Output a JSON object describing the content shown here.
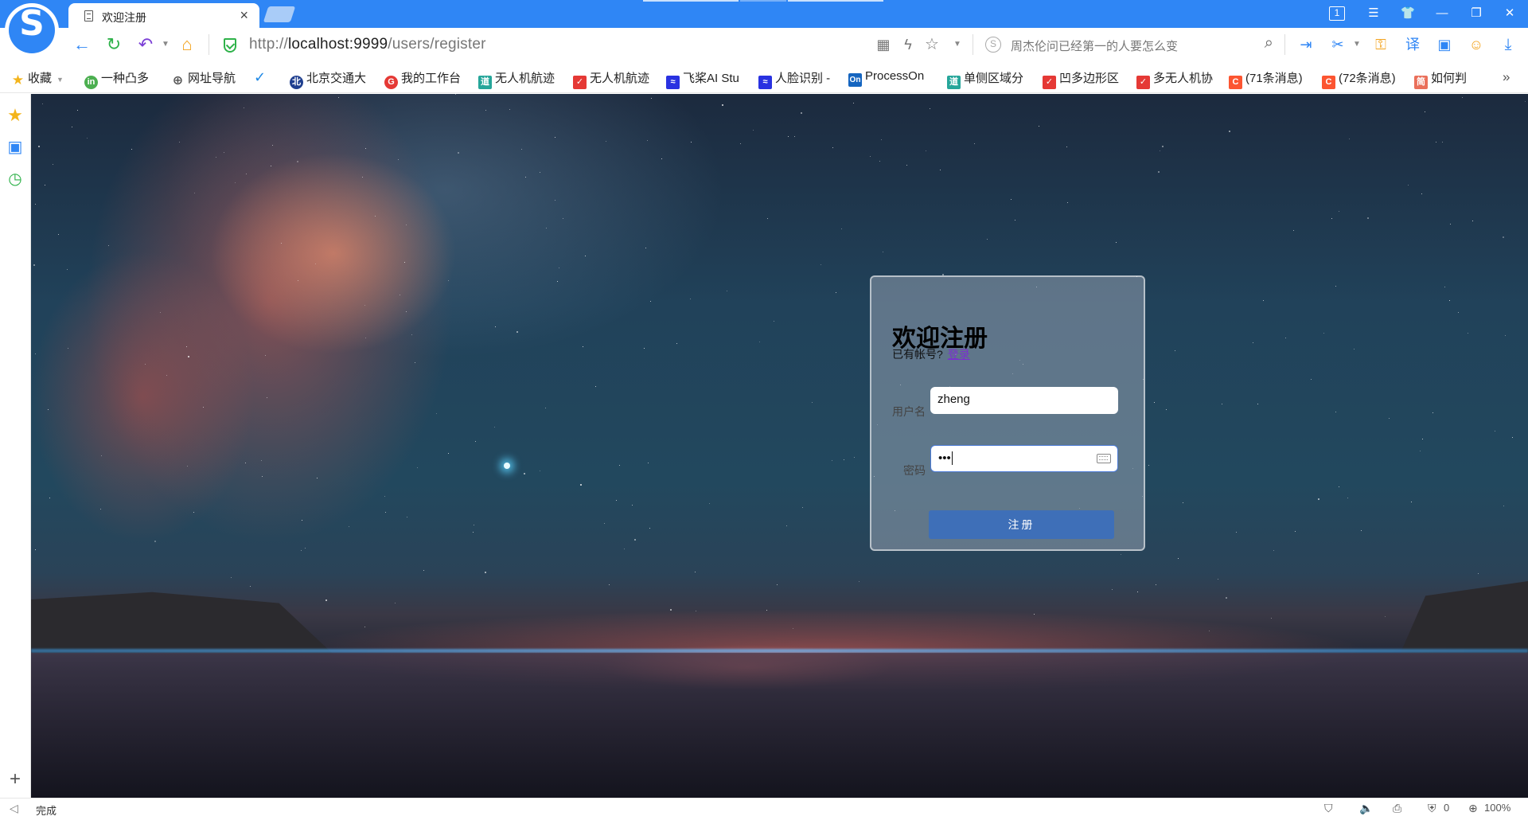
{
  "tab": {
    "title": "欢迎注册",
    "close": "×"
  },
  "address": {
    "scheme": "http://",
    "host": "localhost:9999",
    "path": "/users/register"
  },
  "search": {
    "text": "周杰伦问已经第一的人要怎么变"
  },
  "bookmarks": [
    {
      "label": "收藏",
      "icon": "star-icon",
      "color": "#f3b41b"
    },
    {
      "label": "一种凸多",
      "icon": "in-icon",
      "color": "#4caf50"
    },
    {
      "label": "网址导航",
      "icon": "globe-icon",
      "color": "#555"
    },
    {
      "label": "",
      "icon": "check-icon",
      "color": "#1e88e5"
    },
    {
      "label": "北京交通大",
      "icon": "university-icon",
      "color": "#1f3f8f"
    },
    {
      "label": "我的工作台",
      "icon": "g-icon",
      "color": "#e53935"
    },
    {
      "label": "无人机航迹",
      "icon": "paper-icon",
      "color": "#26a69a"
    },
    {
      "label": "无人机航迹",
      "icon": "paper-red-icon",
      "color": "#e53935"
    },
    {
      "label": "飞桨AI Stu",
      "icon": "paddle-icon",
      "color": "#2932e1"
    },
    {
      "label": "人脸识别 -",
      "icon": "paddle-icon",
      "color": "#2932e1"
    },
    {
      "label": "ProcessOn",
      "icon": "processon-icon",
      "color": "#1565c0"
    },
    {
      "label": "单侧区域分",
      "icon": "paper-icon",
      "color": "#26a69a"
    },
    {
      "label": "凹多边形区",
      "icon": "paper-red-icon",
      "color": "#e53935"
    },
    {
      "label": "多无人机协",
      "icon": "paper-red-icon",
      "color": "#e53935"
    },
    {
      "label": "(71条消息)",
      "icon": "csdn-icon",
      "color": "#fc5531"
    },
    {
      "label": "(72条消息)",
      "icon": "csdn-icon",
      "color": "#fc5531"
    },
    {
      "label": "如何判",
      "icon": "jian-icon",
      "color": "#ea6f5a"
    }
  ],
  "form": {
    "title": "欢迎注册",
    "subtitle": "已有帐号?",
    "login_link": "登录",
    "username_label": "用户名",
    "username_value": "zheng",
    "password_label": "密码",
    "password_value": "•••",
    "submit_label": "注册"
  },
  "status": {
    "text": "完成",
    "count": "0",
    "zoom": "100%"
  },
  "colors": {
    "accent": "#2f86f5",
    "submit": "#3e6fb8",
    "link": "#7a2fd0"
  }
}
